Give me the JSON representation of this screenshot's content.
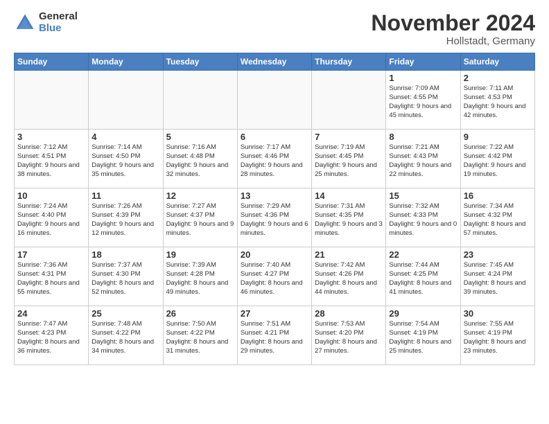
{
  "header": {
    "logo_general": "General",
    "logo_blue": "Blue",
    "month_title": "November 2024",
    "location": "Hollstadt, Germany"
  },
  "weekdays": [
    "Sunday",
    "Monday",
    "Tuesday",
    "Wednesday",
    "Thursday",
    "Friday",
    "Saturday"
  ],
  "weeks": [
    [
      {
        "day": "",
        "info": ""
      },
      {
        "day": "",
        "info": ""
      },
      {
        "day": "",
        "info": ""
      },
      {
        "day": "",
        "info": ""
      },
      {
        "day": "",
        "info": ""
      },
      {
        "day": "1",
        "info": "Sunrise: 7:09 AM\nSunset: 4:55 PM\nDaylight: 9 hours\nand 45 minutes."
      },
      {
        "day": "2",
        "info": "Sunrise: 7:11 AM\nSunset: 4:53 PM\nDaylight: 9 hours\nand 42 minutes."
      }
    ],
    [
      {
        "day": "3",
        "info": "Sunrise: 7:12 AM\nSunset: 4:51 PM\nDaylight: 9 hours\nand 38 minutes."
      },
      {
        "day": "4",
        "info": "Sunrise: 7:14 AM\nSunset: 4:50 PM\nDaylight: 9 hours\nand 35 minutes."
      },
      {
        "day": "5",
        "info": "Sunrise: 7:16 AM\nSunset: 4:48 PM\nDaylight: 9 hours\nand 32 minutes."
      },
      {
        "day": "6",
        "info": "Sunrise: 7:17 AM\nSunset: 4:46 PM\nDaylight: 9 hours\nand 28 minutes."
      },
      {
        "day": "7",
        "info": "Sunrise: 7:19 AM\nSunset: 4:45 PM\nDaylight: 9 hours\nand 25 minutes."
      },
      {
        "day": "8",
        "info": "Sunrise: 7:21 AM\nSunset: 4:43 PM\nDaylight: 9 hours\nand 22 minutes."
      },
      {
        "day": "9",
        "info": "Sunrise: 7:22 AM\nSunset: 4:42 PM\nDaylight: 9 hours\nand 19 minutes."
      }
    ],
    [
      {
        "day": "10",
        "info": "Sunrise: 7:24 AM\nSunset: 4:40 PM\nDaylight: 9 hours\nand 16 minutes."
      },
      {
        "day": "11",
        "info": "Sunrise: 7:26 AM\nSunset: 4:39 PM\nDaylight: 9 hours\nand 12 minutes."
      },
      {
        "day": "12",
        "info": "Sunrise: 7:27 AM\nSunset: 4:37 PM\nDaylight: 9 hours\nand 9 minutes."
      },
      {
        "day": "13",
        "info": "Sunrise: 7:29 AM\nSunset: 4:36 PM\nDaylight: 9 hours\nand 6 minutes."
      },
      {
        "day": "14",
        "info": "Sunrise: 7:31 AM\nSunset: 4:35 PM\nDaylight: 9 hours\nand 3 minutes."
      },
      {
        "day": "15",
        "info": "Sunrise: 7:32 AM\nSunset: 4:33 PM\nDaylight: 9 hours\nand 0 minutes."
      },
      {
        "day": "16",
        "info": "Sunrise: 7:34 AM\nSunset: 4:32 PM\nDaylight: 8 hours\nand 57 minutes."
      }
    ],
    [
      {
        "day": "17",
        "info": "Sunrise: 7:36 AM\nSunset: 4:31 PM\nDaylight: 8 hours\nand 55 minutes."
      },
      {
        "day": "18",
        "info": "Sunrise: 7:37 AM\nSunset: 4:30 PM\nDaylight: 8 hours\nand 52 minutes."
      },
      {
        "day": "19",
        "info": "Sunrise: 7:39 AM\nSunset: 4:28 PM\nDaylight: 8 hours\nand 49 minutes."
      },
      {
        "day": "20",
        "info": "Sunrise: 7:40 AM\nSunset: 4:27 PM\nDaylight: 8 hours\nand 46 minutes."
      },
      {
        "day": "21",
        "info": "Sunrise: 7:42 AM\nSunset: 4:26 PM\nDaylight: 8 hours\nand 44 minutes."
      },
      {
        "day": "22",
        "info": "Sunrise: 7:44 AM\nSunset: 4:25 PM\nDaylight: 8 hours\nand 41 minutes."
      },
      {
        "day": "23",
        "info": "Sunrise: 7:45 AM\nSunset: 4:24 PM\nDaylight: 8 hours\nand 39 minutes."
      }
    ],
    [
      {
        "day": "24",
        "info": "Sunrise: 7:47 AM\nSunset: 4:23 PM\nDaylight: 8 hours\nand 36 minutes."
      },
      {
        "day": "25",
        "info": "Sunrise: 7:48 AM\nSunset: 4:22 PM\nDaylight: 8 hours\nand 34 minutes."
      },
      {
        "day": "26",
        "info": "Sunrise: 7:50 AM\nSunset: 4:22 PM\nDaylight: 8 hours\nand 31 minutes."
      },
      {
        "day": "27",
        "info": "Sunrise: 7:51 AM\nSunset: 4:21 PM\nDaylight: 8 hours\nand 29 minutes."
      },
      {
        "day": "28",
        "info": "Sunrise: 7:53 AM\nSunset: 4:20 PM\nDaylight: 8 hours\nand 27 minutes."
      },
      {
        "day": "29",
        "info": "Sunrise: 7:54 AM\nSunset: 4:19 PM\nDaylight: 8 hours\nand 25 minutes."
      },
      {
        "day": "30",
        "info": "Sunrise: 7:55 AM\nSunset: 4:19 PM\nDaylight: 8 hours\nand 23 minutes."
      }
    ]
  ]
}
